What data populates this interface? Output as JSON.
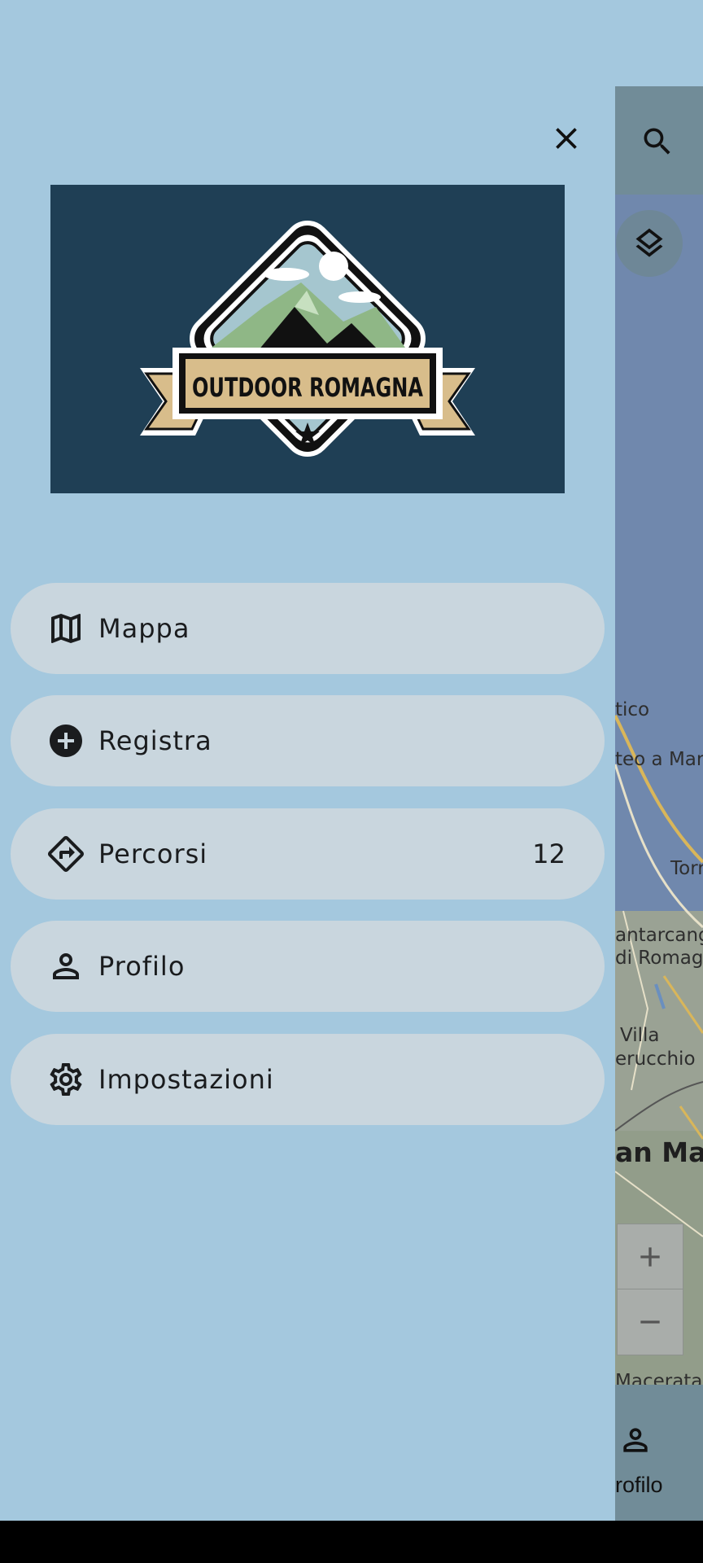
{
  "drawer": {
    "close_icon": "close-icon",
    "logo": {
      "text": "OUTDOOR ROMAGNA",
      "colors": {
        "background": "#1f3f55",
        "banner": "#d8bd8b",
        "sky": "#a5c6cf",
        "mountain": "#8fb786"
      }
    },
    "items": [
      {
        "label": "Mappa",
        "icon": "map-icon"
      },
      {
        "label": "Registra",
        "icon": "add-circle-icon"
      },
      {
        "label": "Percorsi",
        "icon": "directions-icon",
        "count": "12"
      },
      {
        "label": "Profilo",
        "icon": "person-icon"
      },
      {
        "label": "Impostazioni",
        "icon": "settings-icon"
      }
    ]
  },
  "map": {
    "labels": [
      "tico",
      "teo a Mare",
      "Torr",
      "antarcange",
      "di Romagn",
      "Villa",
      "erucchio",
      "an Mar",
      "Macerata"
    ],
    "nav_label": "rofilo"
  },
  "colors": {
    "drawer_bg": "#a4c8de",
    "menu_item_bg": "#c9d6de",
    "appbar_bg": "#718c98"
  }
}
